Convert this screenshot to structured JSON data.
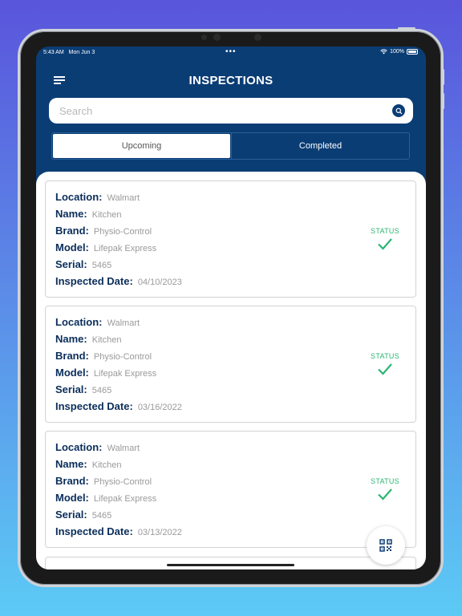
{
  "status_bar": {
    "time": "5:43 AM",
    "date": "Mon Jun 3",
    "battery": "100%"
  },
  "header": {
    "title": "INSPECTIONS",
    "menu_icon": "hamburger-menu-icon"
  },
  "search": {
    "placeholder": "Search",
    "value": "",
    "icon": "search-icon"
  },
  "tabs": [
    {
      "label": "Upcoming",
      "active": true
    },
    {
      "label": "Completed",
      "active": false
    }
  ],
  "labels": {
    "location": "Location:",
    "name": "Name:",
    "brand": "Brand:",
    "model": "Model:",
    "serial": "Serial:",
    "inspected_date": "Inspected Date:",
    "status": "STATUS"
  },
  "inspections": [
    {
      "location": "Walmart",
      "name": "Kitchen",
      "brand": "Physio-Control",
      "model": "Lifepak Express",
      "serial": "5465",
      "inspected_date": "04/10/2023",
      "status_icon": "checkmark-icon"
    },
    {
      "location": "Walmart",
      "name": "Kitchen",
      "brand": "Physio-Control",
      "model": "Lifepak Express",
      "serial": "5465",
      "inspected_date": "03/16/2022",
      "status_icon": "checkmark-icon"
    },
    {
      "location": "Walmart",
      "name": "Kitchen",
      "brand": "Physio-Control",
      "model": "Lifepak Express",
      "serial": "5465",
      "inspected_date": "03/13/2022",
      "status_icon": "checkmark-icon"
    }
  ],
  "fab": {
    "icon": "qr-code-icon"
  },
  "colors": {
    "primary": "#0b3d75",
    "status_green": "#2bb673",
    "label_navy": "#0a2d5a"
  }
}
